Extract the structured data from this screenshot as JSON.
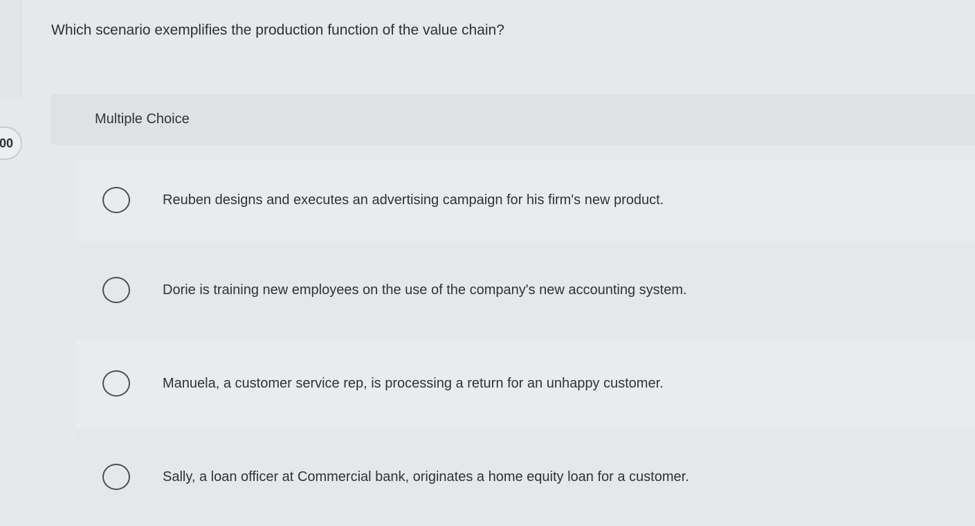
{
  "points_badge": "00",
  "question": "Which scenario exemplifies the production function of the value chain?",
  "question_type": "Multiple Choice",
  "options": [
    {
      "label": "Reuben designs and executes an advertising campaign for his firm's new product.",
      "selected": false
    },
    {
      "label": "Dorie is training new employees on the use of the company's new accounting system.",
      "selected": false
    },
    {
      "label": "Manuela, a customer service rep, is processing a return for an unhappy customer.",
      "selected": false
    },
    {
      "label": "Sally, a loan officer at Commercial bank, originates a home equity loan for a customer.",
      "selected": false
    }
  ]
}
